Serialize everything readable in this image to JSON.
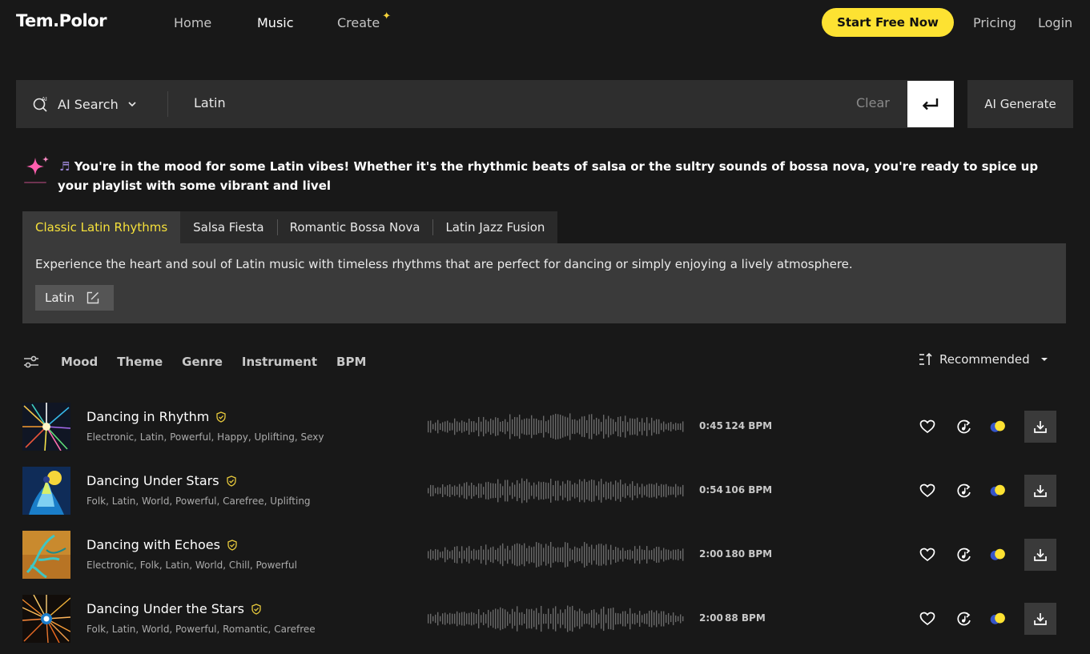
{
  "nav": {
    "logo": "Tem.Polor",
    "links": [
      "Home",
      "Music",
      "Create"
    ],
    "start_button": "Start Free Now",
    "pricing": "Pricing",
    "login": "Login"
  },
  "search": {
    "mode_label": "AI Search",
    "query": "Latin",
    "clear_label": "Clear",
    "ai_generate_label": "AI Generate"
  },
  "ai_message": "You're in the mood for some Latin vibes! Whether it's the rhythmic beats of salsa or the sultry sounds of bossa nova, you're ready to spice up your playlist with some vibrant and livel",
  "tabs": {
    "items": [
      "Classic Latin Rhythms",
      "Salsa Fiesta",
      "Romantic Bossa Nova",
      "Latin Jazz Fusion"
    ],
    "active_index": 0,
    "description": "Experience the heart and soul of Latin music with timeless rhythms that are perfect for dancing or simply enjoying a lively atmosphere.",
    "tag_chip": "Latin"
  },
  "filters": {
    "items": [
      "Mood",
      "Theme",
      "Genre",
      "Instrument",
      "BPM"
    ],
    "sort_label": "Recommended"
  },
  "tracks": [
    {
      "title": "Dancing in Rhythm",
      "tags": "Electronic, Latin, Powerful, Happy, Uplifting, Sexy",
      "duration": "0:45",
      "bpm": "124 BPM"
    },
    {
      "title": "Dancing Under Stars",
      "tags": "Folk, Latin, World, Powerful, Carefree, Uplifting",
      "duration": "0:54",
      "bpm": "106 BPM"
    },
    {
      "title": "Dancing with Echoes",
      "tags": "Electronic, Folk, Latin, World, Chill, Powerful",
      "duration": "2:00",
      "bpm": "180 BPM"
    },
    {
      "title": "Dancing Under the Stars",
      "tags": "Folk, Latin, World, Powerful, Romantic, Carefree",
      "duration": "2:00",
      "bpm": "88 BPM"
    }
  ],
  "colors": {
    "accent_yellow": "#fde232",
    "active_tab_text": "#f5e03a",
    "background": "#181818",
    "panel": "#2e2e2e",
    "sparkle_pink": "#ff5fae"
  }
}
